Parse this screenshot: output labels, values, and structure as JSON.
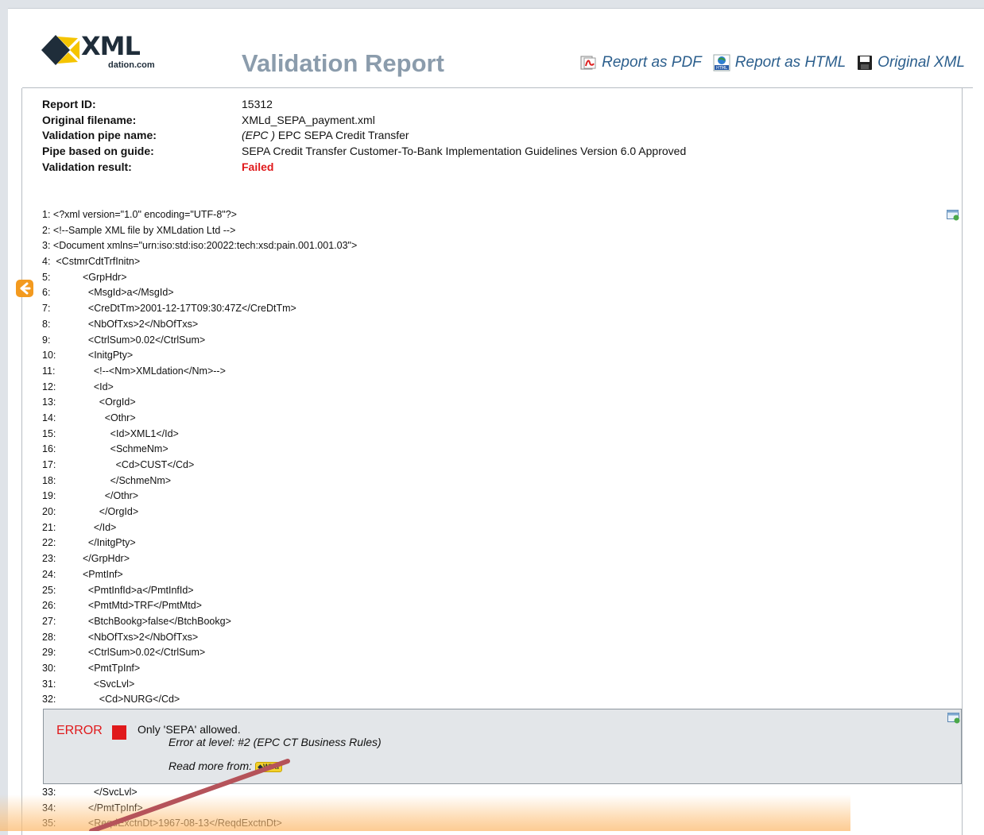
{
  "header": {
    "logo_word": "XML",
    "logo_sub": "dation.com",
    "title": "Validation Report",
    "links": [
      {
        "label": "Report as PDF",
        "icon": "pdf-icon"
      },
      {
        "label": "Report as HTML",
        "icon": "html-report-icon"
      },
      {
        "label": "Original XML",
        "icon": "save-disk-icon"
      }
    ]
  },
  "report": {
    "fields": [
      {
        "label": "Report ID:",
        "value": "15312"
      },
      {
        "label": "Original filename:",
        "value": "XMLd_SEPA_payment.xml"
      },
      {
        "label": "Validation pipe name:",
        "value_prefix": "(EPC )",
        "value": " EPC SEPA Credit Transfer"
      },
      {
        "label": "Pipe based on guide:",
        "value": "SEPA Credit Transfer Customer-To-Bank Implementation Guidelines Version 6.0 Approved"
      },
      {
        "label": "Validation result:",
        "value": "Failed"
      }
    ]
  },
  "code_lines": [
    "1: <?xml version=\"1.0\" encoding=\"UTF-8\"?>",
    "2: <!--Sample XML file by XMLdation Ltd -->",
    "3: <Document xmlns=\"urn:iso:std:iso:20022:tech:xsd:pain.001.001.03\">",
    "4:  <CstmrCdtTrfInitn>",
    [
      "5:",
      "  <GrpHdr>"
    ],
    [
      "6:",
      "    <MsgId>a</MsgId>"
    ],
    [
      "7:",
      "    <CreDtTm>2001-12-17T09:30:47Z</CreDtTm>"
    ],
    [
      "8:",
      "    <NbOfTxs>2</NbOfTxs>"
    ],
    [
      "9:",
      "    <CtrlSum>0.02</CtrlSum>"
    ],
    [
      "10:",
      "    <InitgPty>"
    ],
    [
      "11:",
      "      <!--<Nm>XMLdation</Nm>-->"
    ],
    [
      "12:",
      "      <Id>"
    ],
    [
      "13:",
      "        <OrgId>"
    ],
    [
      "14:",
      "          <Othr>"
    ],
    [
      "15:",
      "            <Id>XML1</Id>"
    ],
    [
      "16:",
      "            <SchmeNm>"
    ],
    [
      "17:",
      "              <Cd>CUST</Cd>"
    ],
    [
      "18:",
      "            </SchmeNm>"
    ],
    [
      "19:",
      "          </Othr>"
    ],
    [
      "20:",
      "        </OrgId>"
    ],
    [
      "21:",
      "      </Id>"
    ],
    [
      "22:",
      "    </InitgPty>"
    ],
    [
      "23:",
      "  </GrpHdr>"
    ],
    [
      "24:",
      "  <PmtInf>"
    ],
    [
      "25:",
      "    <PmtInfId>a</PmtInfId>"
    ],
    [
      "26:",
      "    <PmtMtd>TRF</PmtMtd>"
    ],
    [
      "27:",
      "    <BtchBookg>false</BtchBookg>"
    ],
    [
      "28:",
      "    <NbOfTxs>2</NbOfTxs>"
    ],
    [
      "29:",
      "    <CtrlSum>0.02</CtrlSum>"
    ],
    [
      "30:",
      "    <PmtTpInf>"
    ],
    [
      "31:",
      "      <SvcLvl>"
    ],
    [
      "32:",
      "        <Cd>NURG</Cd>"
    ]
  ],
  "error": {
    "label": "ERROR",
    "message": "Only 'SEPA' allowed.",
    "level": "Error at level: #2 (EPC CT Business Rules)",
    "read_more": "Read more from:",
    "wiki": "WIKI",
    "color": "#e0191b"
  },
  "code_lines_after": [
    [
      "33:",
      "      </SvcLvl>"
    ],
    [
      "34:",
      "    </PmtTpInf>"
    ],
    [
      "35:",
      "    <ReqdExctnDt>1967-08-13</ReqdExctnDt>"
    ]
  ],
  "colors": {
    "title": "#8b9cac",
    "link": "#2c5f8d",
    "fail": "#e0191b",
    "accent_orange": "#f39a1f"
  }
}
